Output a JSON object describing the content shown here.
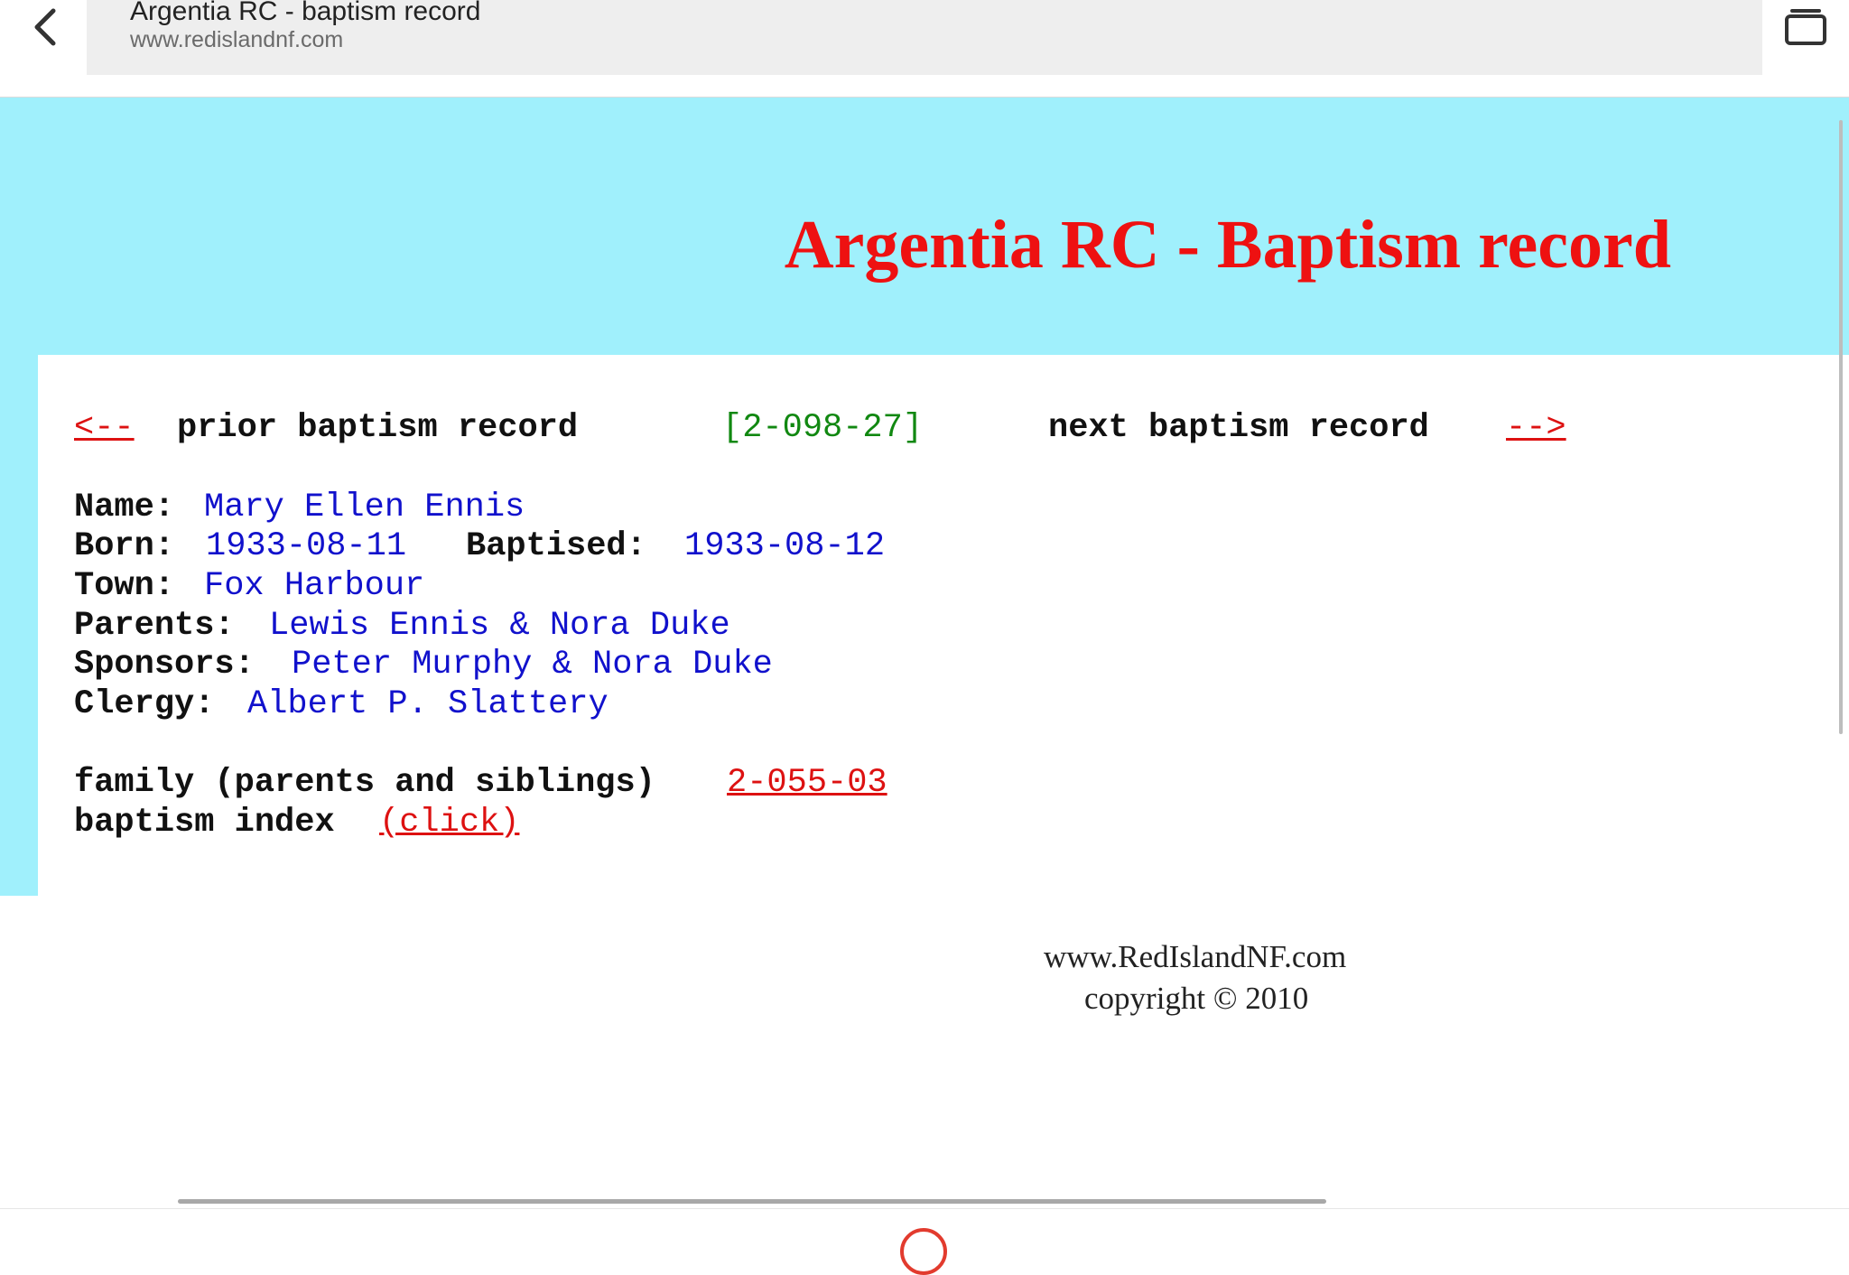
{
  "browser": {
    "tab_title": "Argentia RC - baptism record",
    "domain": "www.redislandnf.com",
    "back_icon": "chevron-left-icon",
    "tabs_icon": "tabs-window-icon"
  },
  "page": {
    "heading": "Argentia RC - Baptism record",
    "nav": {
      "prior_arrow": "<--",
      "prior_label": "prior baptism record",
      "record_id": "[2-098-27]",
      "next_label": "next baptism record",
      "next_arrow": "-->"
    },
    "record": {
      "name_label": "Name:",
      "name_value": "Mary Ellen Ennis",
      "born_label": "Born:",
      "born_value": "1933-08-11",
      "baptised_label": "Baptised:",
      "baptised_value": "1933-08-12",
      "town_label": "Town:",
      "town_value": "Fox Harbour",
      "parents_label": "Parents:",
      "parents_value": "Lewis Ennis & Nora Duke",
      "sponsors_label": "Sponsors:",
      "sponsors_value": "Peter Murphy & Nora Duke",
      "clergy_label": "Clergy:",
      "clergy_value": "Albert P. Slattery"
    },
    "links": {
      "family_label": "family (parents and siblings)",
      "family_link": "2-055-03",
      "index_label": "baptism index",
      "index_link": "(click)"
    },
    "footer": {
      "site": "www.RedIslandNF.com",
      "copyright": "copyright © 2010"
    }
  },
  "colors": {
    "band": "#a0f0fc",
    "heading": "#ee1111",
    "link": "#dd1111",
    "value": "#1111cc",
    "record_id": "#118811"
  }
}
